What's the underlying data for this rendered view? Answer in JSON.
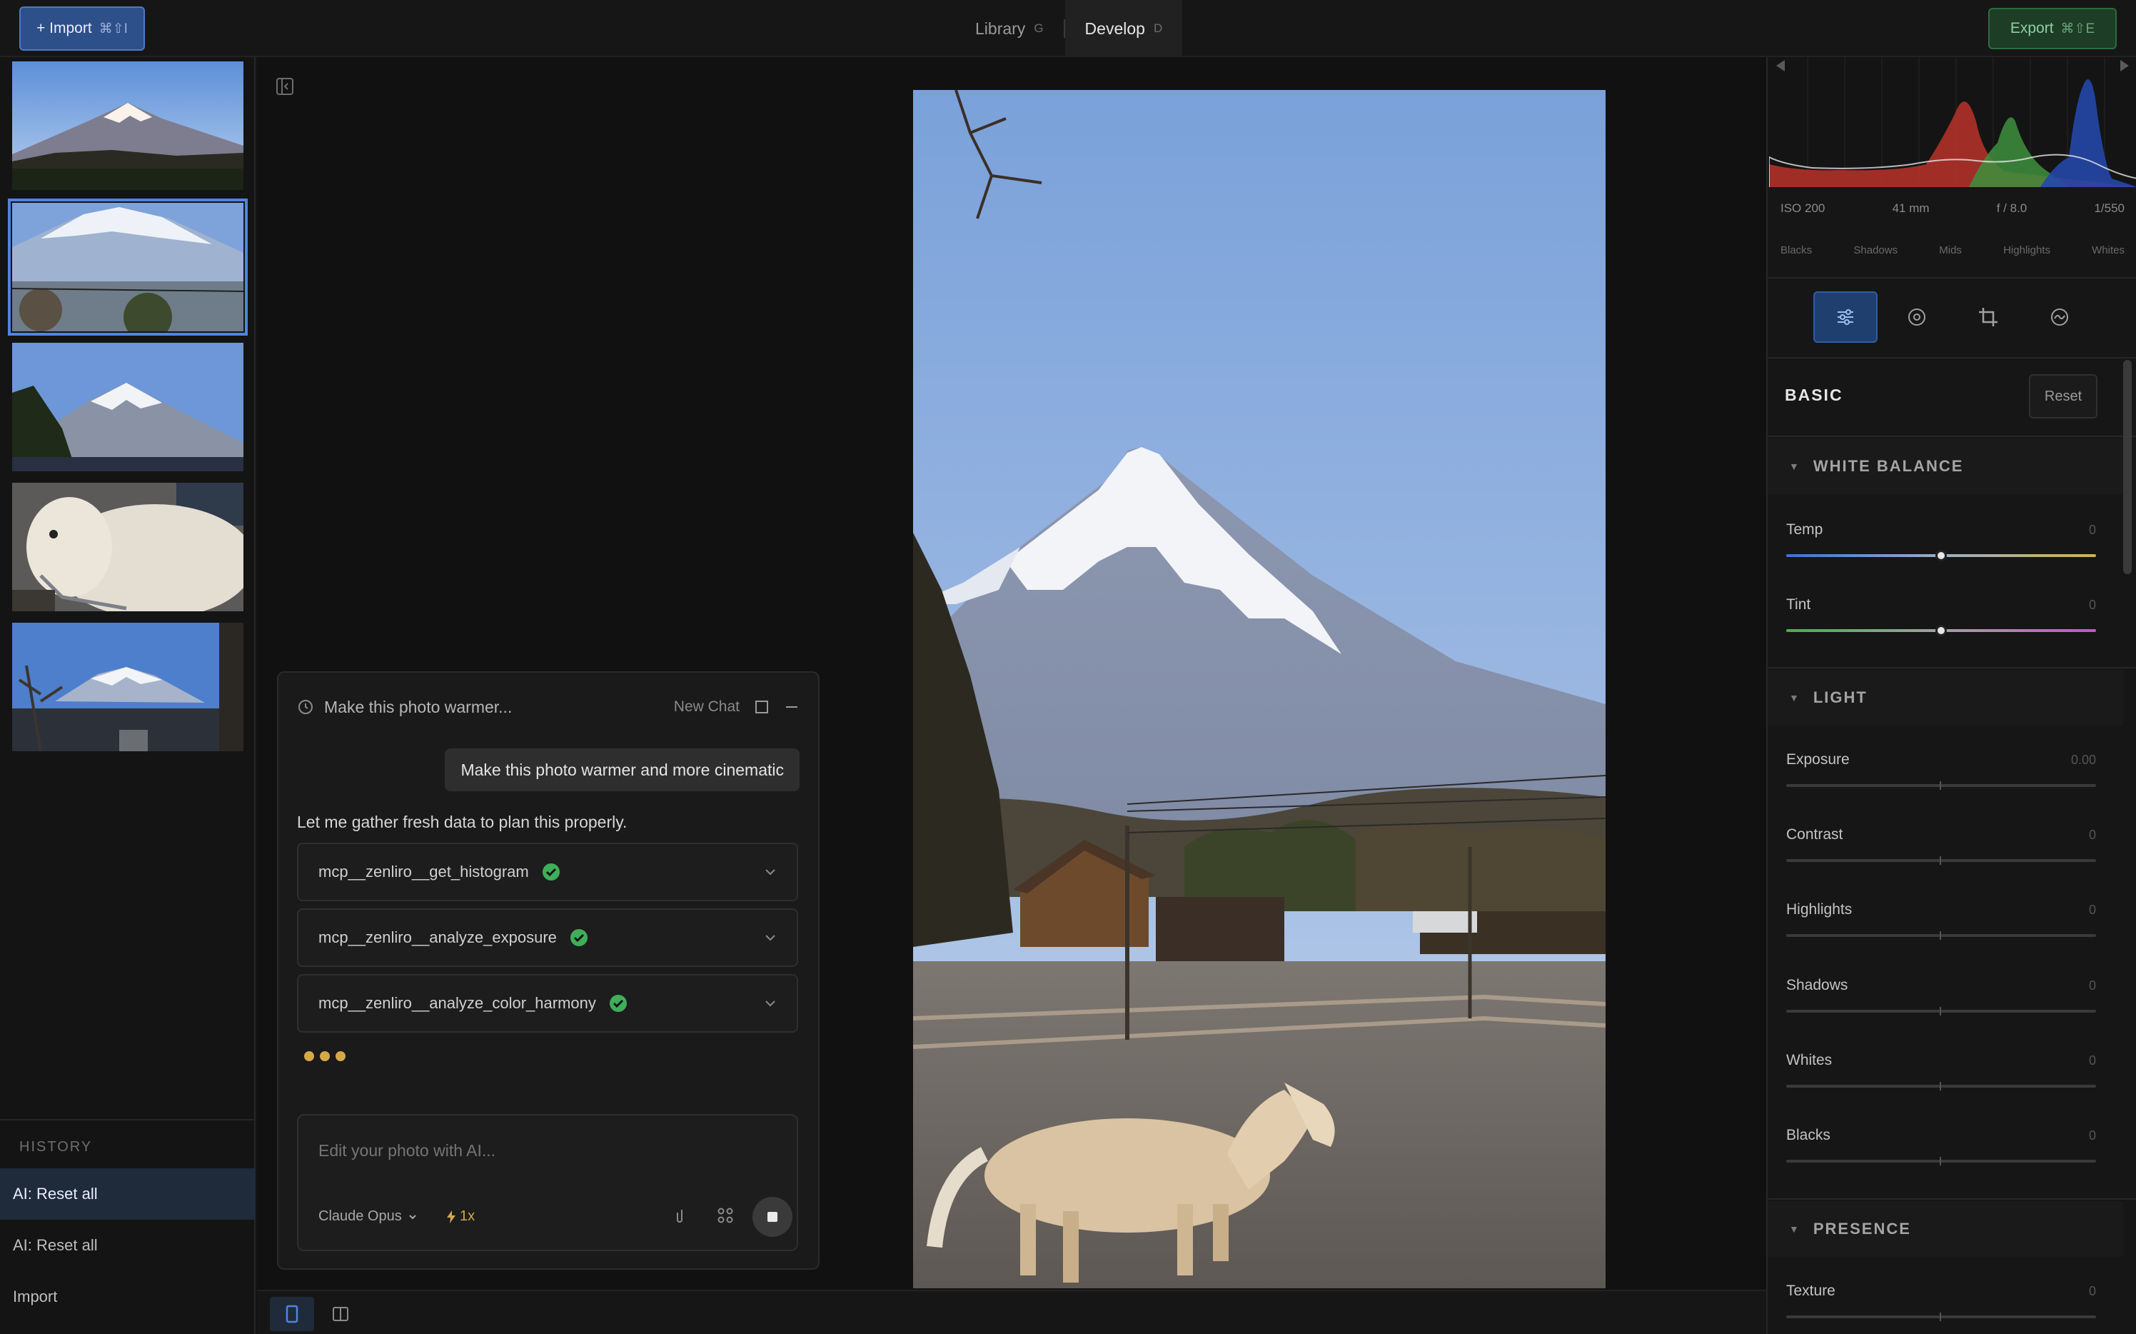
{
  "topbar": {
    "import_label": "+ Import",
    "import_shortcut": "⌘⇧I",
    "tabs": [
      {
        "label": "Library",
        "key": "G"
      },
      {
        "label": "Develop",
        "key": "D"
      }
    ],
    "export_label": "Export",
    "export_shortcut": "⌘⇧E"
  },
  "history": {
    "title": "HISTORY",
    "items": [
      "AI: Reset all",
      "AI: Reset all",
      "Import"
    ]
  },
  "chat": {
    "title": "Make this photo warmer...",
    "new_chat": "New Chat",
    "user_message": "Make this photo warmer and more cinematic",
    "assistant_message": "Let me gather fresh data to plan this properly.",
    "tools": [
      "mcp__zenliro__get_histogram",
      "mcp__zenliro__analyze_exposure",
      "mcp__zenliro__analyze_color_harmony"
    ],
    "input_placeholder": "Edit your photo with AI...",
    "model": "Claude Opus",
    "speed": "1x"
  },
  "exif": {
    "iso": "ISO 200",
    "focal": "41 mm",
    "aperture": "f / 8.0",
    "shutter": "1/550"
  },
  "zones": [
    "Blacks",
    "Shadows",
    "Mids",
    "Highlights",
    "Whites"
  ],
  "basic": {
    "title": "BASIC",
    "reset_label": "Reset"
  },
  "groups": {
    "white_balance": "WHITE BALANCE",
    "light": "LIGHT",
    "presence": "PRESENCE"
  },
  "sliders": {
    "temp": {
      "label": "Temp",
      "value": "0"
    },
    "tint": {
      "label": "Tint",
      "value": "0"
    },
    "exposure": {
      "label": "Exposure",
      "value": "0.00"
    },
    "contrast": {
      "label": "Contrast",
      "value": "0"
    },
    "highlights": {
      "label": "Highlights",
      "value": "0"
    },
    "shadows": {
      "label": "Shadows",
      "value": "0"
    },
    "whites": {
      "label": "Whites",
      "value": "0"
    },
    "blacks": {
      "label": "Blacks",
      "value": "0"
    },
    "texture": {
      "label": "Texture",
      "value": "0"
    }
  },
  "colors": {
    "accent": "#4d86e0",
    "export_green": "#8fd09e",
    "loading": "#d4a94a"
  }
}
